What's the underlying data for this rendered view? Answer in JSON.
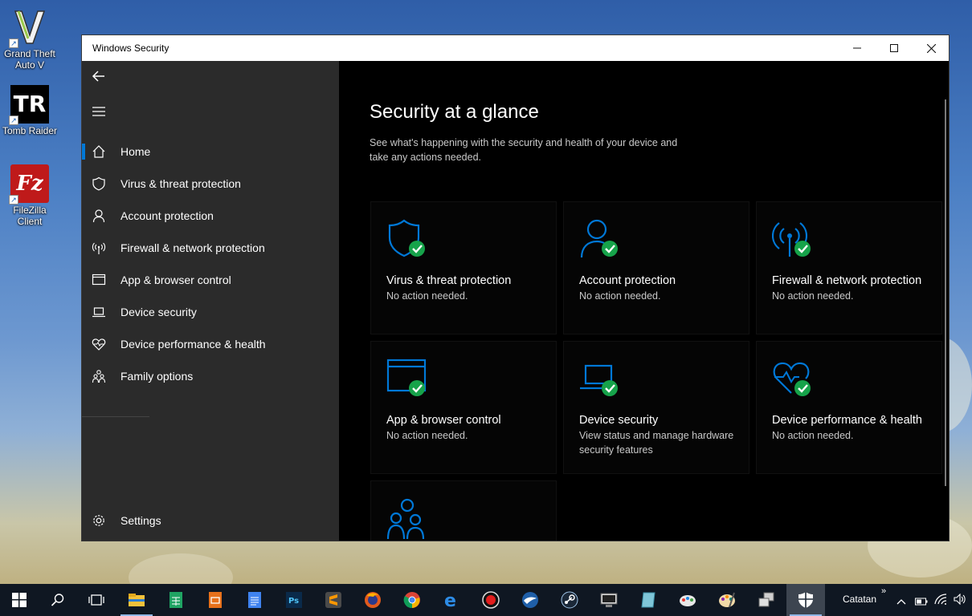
{
  "desktop": {
    "icons": [
      {
        "label": "Grand Theft Auto V",
        "glyph": "V",
        "icon": "gta-icon"
      },
      {
        "label": "Tomb Raider",
        "glyph": "TR",
        "icon": "tomb-raider-icon"
      },
      {
        "label": "FileZilla Client",
        "glyph": "Fz",
        "icon": "filezilla-icon"
      }
    ]
  },
  "window": {
    "title": "Windows Security",
    "controls": {
      "minimize": "—",
      "maximize": "☐",
      "close": "✕"
    }
  },
  "sidebar": {
    "items": [
      {
        "label": "Home",
        "icon": "home-icon",
        "active": true
      },
      {
        "label": "Virus & threat protection",
        "icon": "shield-icon"
      },
      {
        "label": "Account protection",
        "icon": "person-icon"
      },
      {
        "label": "Firewall & network protection",
        "icon": "antenna-icon"
      },
      {
        "label": "App & browser control",
        "icon": "browser-window-icon"
      },
      {
        "label": "Device security",
        "icon": "laptop-icon"
      },
      {
        "label": "Device performance & health",
        "icon": "heart-pulse-icon"
      },
      {
        "label": "Family options",
        "icon": "family-icon"
      }
    ],
    "settings_label": "Settings"
  },
  "main": {
    "heading": "Security at a glance",
    "subheading": "See what's happening with the security and health of your device and take any actions needed.",
    "cards": [
      {
        "title": "Virus & threat protection",
        "status": "No action needed.",
        "icon": "shield-icon"
      },
      {
        "title": "Account protection",
        "status": "No action needed.",
        "icon": "person-icon"
      },
      {
        "title": "Firewall & network protection",
        "status": "No action needed.",
        "icon": "antenna-icon"
      },
      {
        "title": "App & browser control",
        "status": "No action needed.",
        "icon": "browser-window-icon"
      },
      {
        "title": "Device security",
        "status": "View status and manage hardware security features",
        "icon": "laptop-icon"
      },
      {
        "title": "Device performance & health",
        "status": "No action needed.",
        "icon": "heart-pulse-icon"
      },
      {
        "title": "",
        "status": "",
        "icon": "family-icon"
      }
    ]
  },
  "taskbar": {
    "apps": [
      "start",
      "search",
      "task-view",
      "file-explorer",
      "sheets",
      "slides",
      "docs",
      "photoshop",
      "sublime",
      "firefox",
      "chrome",
      "edge",
      "recorder",
      "thunderbird",
      "steam",
      "terminal",
      "notepad",
      "paint",
      "paint-3d",
      "network-tool",
      "windows-security"
    ],
    "tray_label": "Catatan",
    "tray_chevron": "»"
  },
  "colors": {
    "accent": "#0078d7",
    "check": "#16a34a",
    "sidebar": "#2b2b2b",
    "main": "#000000"
  }
}
